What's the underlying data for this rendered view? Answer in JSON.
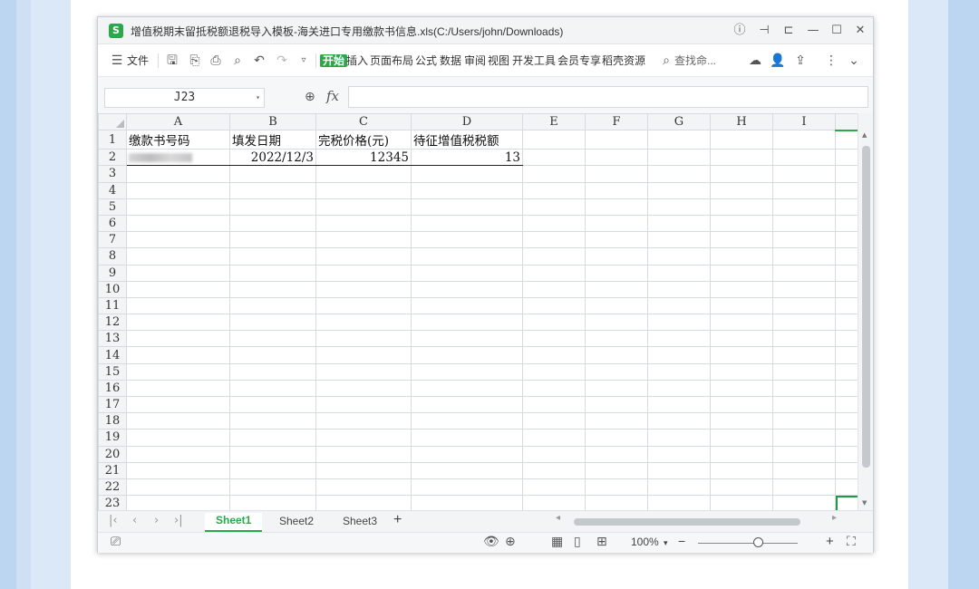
{
  "window": {
    "app_icon_letter": "S",
    "title": "增值税期末留抵税额退税导入模板-海关进口专用缴款书信息.xls(C:/Users/john/Downloads)"
  },
  "ribbon": {
    "menu_label": "文件",
    "tabs": [
      "开始",
      "插入",
      "页面布局",
      "公式",
      "数据",
      "审阅",
      "视图",
      "开发工具",
      "会员专享",
      "稻壳资源"
    ],
    "search_placeholder": "查找命..."
  },
  "formula_bar": {
    "name_box": "J23",
    "fx_label": "fx",
    "formula": ""
  },
  "sheet": {
    "columns": [
      "A",
      "B",
      "C",
      "D",
      "E",
      "F",
      "G",
      "H",
      "I"
    ],
    "row_numbers": [
      "1",
      "2",
      "3",
      "4",
      "5",
      "6",
      "7",
      "8",
      "9",
      "10",
      "11",
      "12",
      "13",
      "14",
      "15",
      "16",
      "17",
      "18",
      "19",
      "20",
      "21",
      "22",
      "23"
    ],
    "headers": [
      "缴款书号码",
      "填发日期",
      "完税价格(元)",
      "待征增值税税额"
    ],
    "row2": {
      "A": "",
      "B": "2022/12/3",
      "C": "12345",
      "D": "13"
    },
    "selected_row": "23",
    "selected_col": "J"
  },
  "tabs": {
    "sheets": [
      "Sheet1",
      "Sheet2",
      "Sheet3"
    ],
    "active": "Sheet1",
    "add_label": "+"
  },
  "status": {
    "zoom": "100%",
    "zoom_caret": "▾",
    "minus": "−",
    "plus": "+"
  },
  "colors": {
    "accent": "#2aa84a",
    "background": "#cfe0f4"
  }
}
